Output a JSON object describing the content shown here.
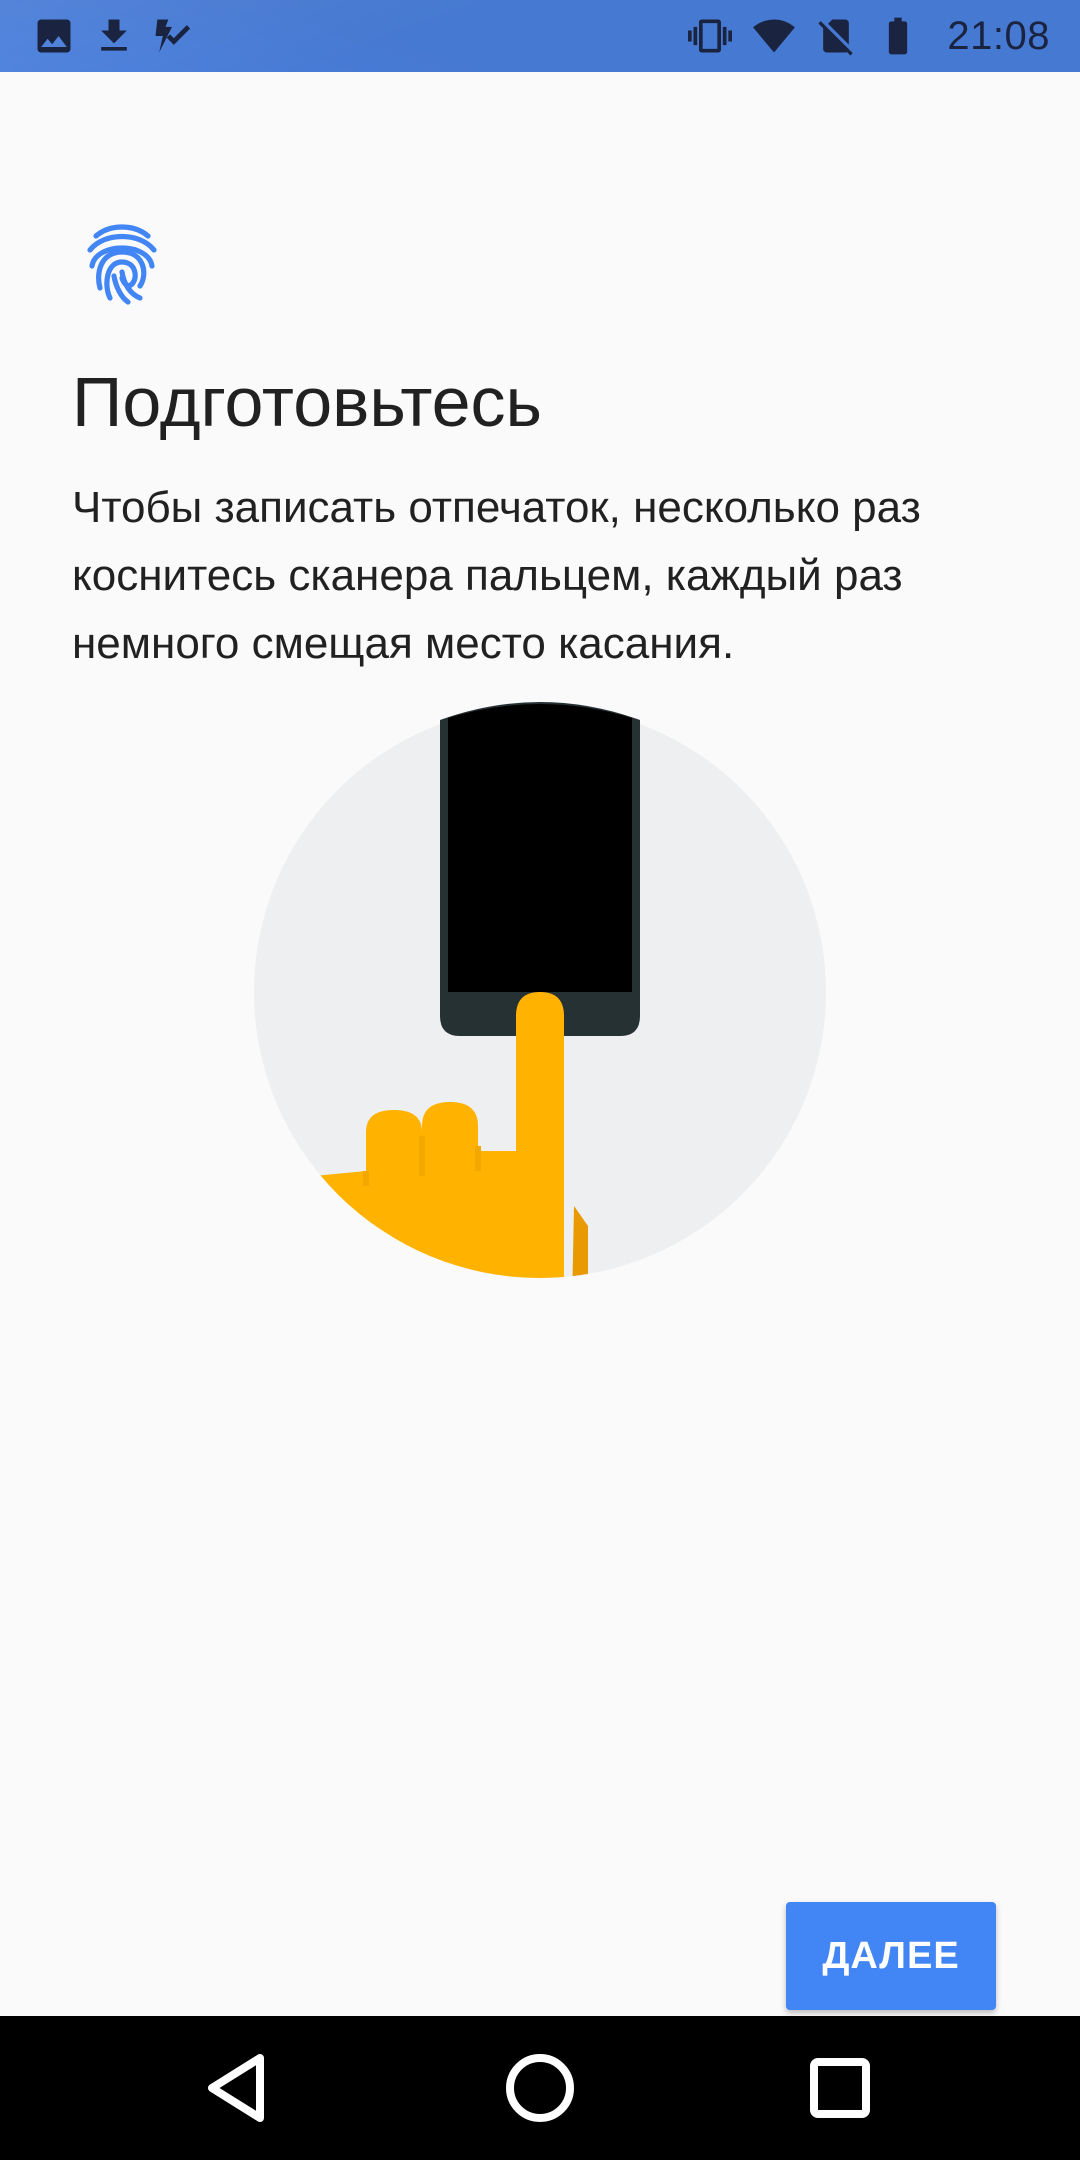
{
  "status_bar": {
    "time": "21:08",
    "left_icons": [
      "image-icon",
      "download-icon",
      "tasks-check-icon"
    ],
    "right_icons": [
      "vibrate-icon",
      "wifi-icon",
      "no-sim-icon",
      "battery-icon"
    ],
    "background": "#4a7fdc"
  },
  "setup": {
    "icon": "fingerprint-icon",
    "title": "Подготовьтесь",
    "description": "Чтобы записать отпечаток, несколько раз коснитесь сканера пальцем, каждый раз немного смещая место касания.",
    "next_button": "ДАЛЕЕ",
    "accent": "#4285f4"
  },
  "illustration": {
    "name": "finger-touching-sensor",
    "circle_color": "#eeeff0",
    "phone_color": "#000000",
    "hand_color": "#ffb300"
  },
  "nav_bar": {
    "buttons": [
      "back-icon",
      "home-icon",
      "recents-icon"
    ]
  }
}
